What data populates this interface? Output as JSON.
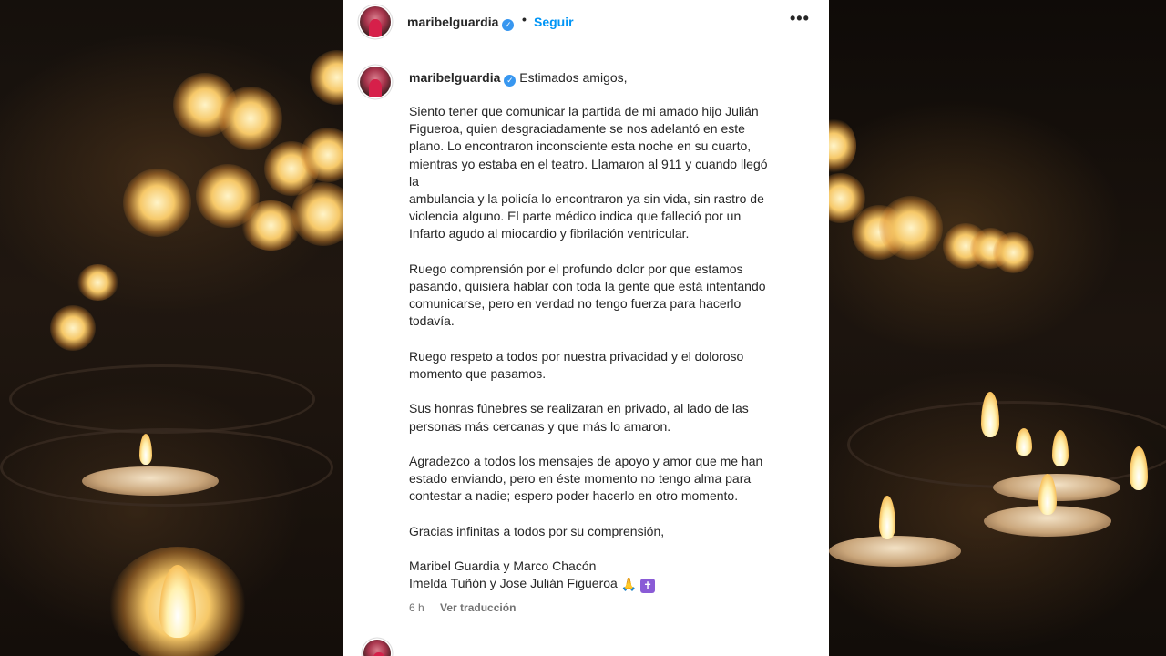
{
  "header": {
    "username": "maribelguardia",
    "separator": "•",
    "follow_label": "Seguir",
    "more_icon": "more-options-icon"
  },
  "caption": {
    "username": "maribelguardia",
    "opening": "Estimados amigos,",
    "paragraphs": [
      "Siento tener que comunicar la partida de mi amado hijo Julián\nFigueroa, quien desgraciadamente se nos adelantó en este\nplano. Lo encontraron inconsciente esta noche en su cuarto,\nmientras yo estaba en el teatro. Llamaron al 911 y cuando llegó\nla\nambulancia y la policía lo encontraron ya sin vida, sin rastro de\nviolencia alguno. El parte médico indica que falleció por un\nInfarto agudo al miocardio y fibrilación ventricular.",
      "Ruego comprensión por el profundo dolor por que estamos\npasando, quisiera hablar con toda la gente que está intentando\ncomunicarse, pero en verdad no tengo fuerza para hacerlo\ntodavía.",
      "Ruego respeto a todos por nuestra privacidad y el doloroso\nmomento que pasamos.",
      "Sus honras fúnebres se realizaran en privado, al lado de las\npersonas más cercanas y que más lo amaron.",
      "Agradezco a todos los mensajes de apoyo y amor que me han\nestado enviando, pero en éste momento no tengo alma para\ncontestar a nadie; espero poder hacerlo en otro momento.",
      "Gracias infinitas a todos por su comprensión,"
    ],
    "signature_line1": "Maribel Guardia y Marco Chacón",
    "signature_line2": "Imelda Tuñón y Jose Julián Figueroa",
    "emoji_pray": "🙏",
    "emoji_cross": "✝"
  },
  "meta": {
    "time": "6 h",
    "translate_label": "Ver traducción"
  },
  "colors": {
    "link_blue": "#0095f6",
    "verified_blue": "#3897f0",
    "text": "#262626",
    "muted": "#737373"
  }
}
